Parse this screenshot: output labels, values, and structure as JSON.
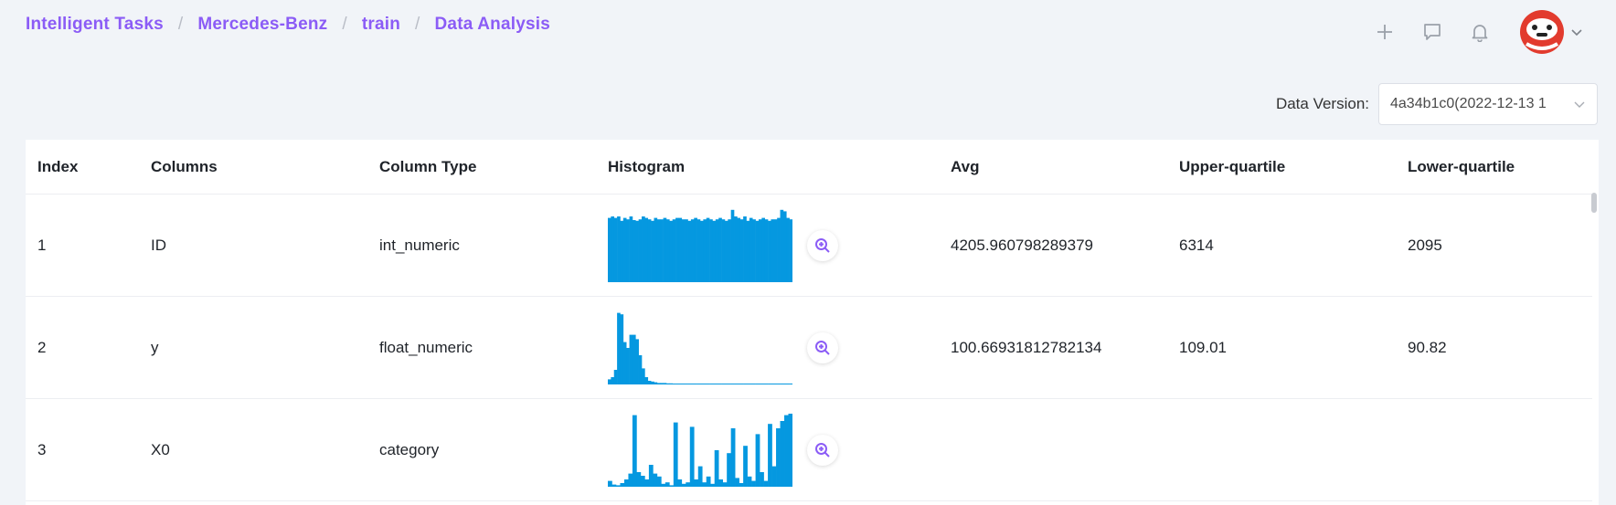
{
  "breadcrumb": [
    "Intelligent Tasks",
    "Mercedes-Benz",
    "train",
    "Data Analysis"
  ],
  "header_icons": [
    "plus-icon",
    "message-icon",
    "bell-icon",
    "user-avatar",
    "chevron-down-icon"
  ],
  "data_version": {
    "label": "Data Version:",
    "value": "4a34b1c0(2022-12-13 1"
  },
  "table": {
    "headers": [
      "Index",
      "Columns",
      "Column Type",
      "Histogram",
      "Avg",
      "Upper-quartile",
      "Lower-quartile"
    ],
    "rows": [
      {
        "index": "1",
        "column": "ID",
        "type": "int_numeric",
        "avg": "4205.960798289379",
        "upper": "6314",
        "lower": "2095",
        "histogram": [
          0.88,
          0.9,
          0.88,
          0.9,
          0.84,
          0.88,
          0.86,
          0.9,
          0.85,
          0.84,
          0.86,
          0.9,
          0.88,
          0.86,
          0.84,
          0.88,
          0.86,
          0.86,
          0.88,
          0.86,
          0.84,
          0.86,
          0.88,
          0.88,
          0.86,
          0.86,
          0.84,
          0.86,
          0.88,
          0.86,
          0.84,
          0.86,
          0.88,
          0.86,
          0.84,
          0.86,
          0.88,
          0.86,
          0.84,
          0.86,
          0.99,
          0.9,
          0.88,
          0.86,
          0.9,
          0.84,
          0.88,
          0.86,
          0.84,
          0.86,
          0.88,
          0.86,
          0.84,
          0.86,
          0.86,
          0.88,
          0.99,
          0.97,
          0.88,
          0.86
        ]
      },
      {
        "index": "2",
        "column": "y",
        "type": "float_numeric",
        "avg": "100.66931812782134",
        "upper": "109.01",
        "lower": "90.82",
        "histogram": [
          0.07,
          0.1,
          0.2,
          0.98,
          0.96,
          0.58,
          0.5,
          0.68,
          0.68,
          0.62,
          0.4,
          0.22,
          0.1,
          0.05,
          0.04,
          0.03,
          0.02,
          0.02,
          0.02,
          0.015,
          0.015,
          0.012,
          0.01,
          0.01,
          0.01,
          0.01,
          0.01,
          0.01,
          0.01,
          0.01,
          0.01,
          0.01,
          0.01,
          0.01,
          0.01,
          0.01,
          0.01,
          0.01,
          0.01,
          0.01,
          0.01,
          0.01,
          0.01,
          0.01,
          0.01,
          0.01,
          0.01,
          0.01,
          0.01,
          0.01,
          0.01,
          0.01,
          0.01,
          0.01,
          0.01,
          0.01,
          0.01,
          0.01,
          0.01,
          0.01
        ]
      },
      {
        "index": "3",
        "column": "X0",
        "type": "category",
        "avg": "",
        "upper": "",
        "lower": "",
        "histogram": [
          0.08,
          0.03,
          0.02,
          0.05,
          0.1,
          0.18,
          0.98,
          0.2,
          0.15,
          0.1,
          0.3,
          0.18,
          0.14,
          0.04,
          0.06,
          0.02,
          0.88,
          0.1,
          0.04,
          0.06,
          0.82,
          0.1,
          0.28,
          0.06,
          0.14,
          0.04,
          0.5,
          0.1,
          0.06,
          0.46,
          0.8,
          0.12,
          0.05,
          0.56,
          0.14,
          0.08,
          0.72,
          0.2,
          0.08,
          0.86,
          0.28,
          0.8,
          0.9,
          0.98,
          1.0
        ]
      }
    ]
  },
  "colors": {
    "accent": "#8b5cf6",
    "histogram": "#0598e0",
    "icon": "#9aa0a9"
  }
}
